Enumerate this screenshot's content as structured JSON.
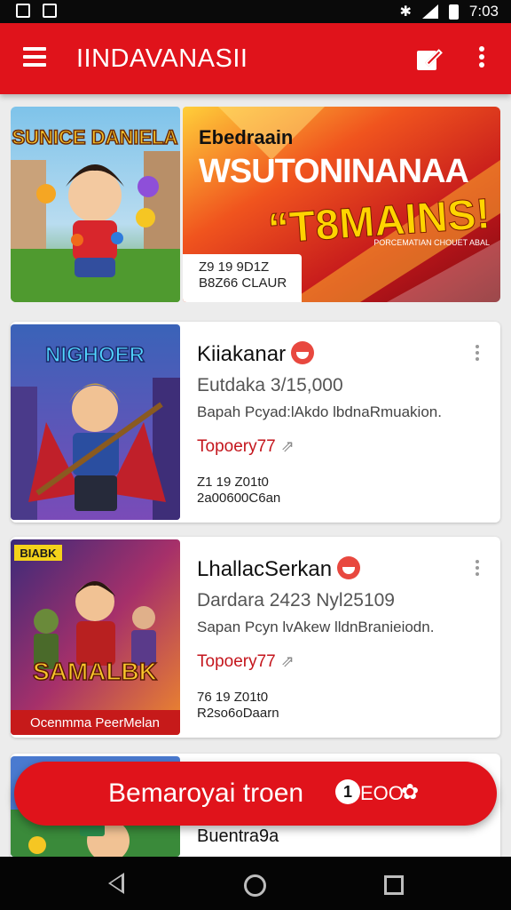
{
  "status_bar": {
    "time": "7:03"
  },
  "app_bar": {
    "title": "IINDAVANASII"
  },
  "banner": {
    "thumb_title": "SUNICE DANIELA",
    "small_text": "Ebedraain",
    "big_text": "WSUTONINANAA",
    "big_text2": "“T8MAINS!",
    "tiny_text": "PORCEMATIAN CHOUET ABAL",
    "label_line1": "Z9 19 9D1Z",
    "label_line2": "B8Z66 CLAUR"
  },
  "cards": [
    {
      "thumb_title": "NIGHOER",
      "title": "Kiiakanar",
      "subtitle": "Eutdaka 3/15,000",
      "description": "Bapah Pcyad:lAkdo lbdnaRmuakion.",
      "tag": "Topoery77",
      "meta1": "Z1 19 Z01t0",
      "meta2": "2a00600C6an"
    },
    {
      "thumb_badge": "BIABK",
      "thumb_title": "SAMALBK",
      "thumb_footer": "Ocenmma PeerMelan",
      "title": "LhallacSerkan",
      "subtitle": "Dardara 2423 Nyl25109",
      "description": "Sapan Pcyn lvAkew lldnBranieiodn.",
      "tag": "Topoery77",
      "meta1": "76 19 Z01t0",
      "meta2": "R2so6oDaarn"
    },
    {
      "title": "Buentra9a"
    }
  ],
  "fab": {
    "label": "Bemarоyai troen",
    "badge": "1",
    "count": "EOO"
  },
  "colors": {
    "brand": "#e0131b",
    "accent": "#c4151c"
  }
}
